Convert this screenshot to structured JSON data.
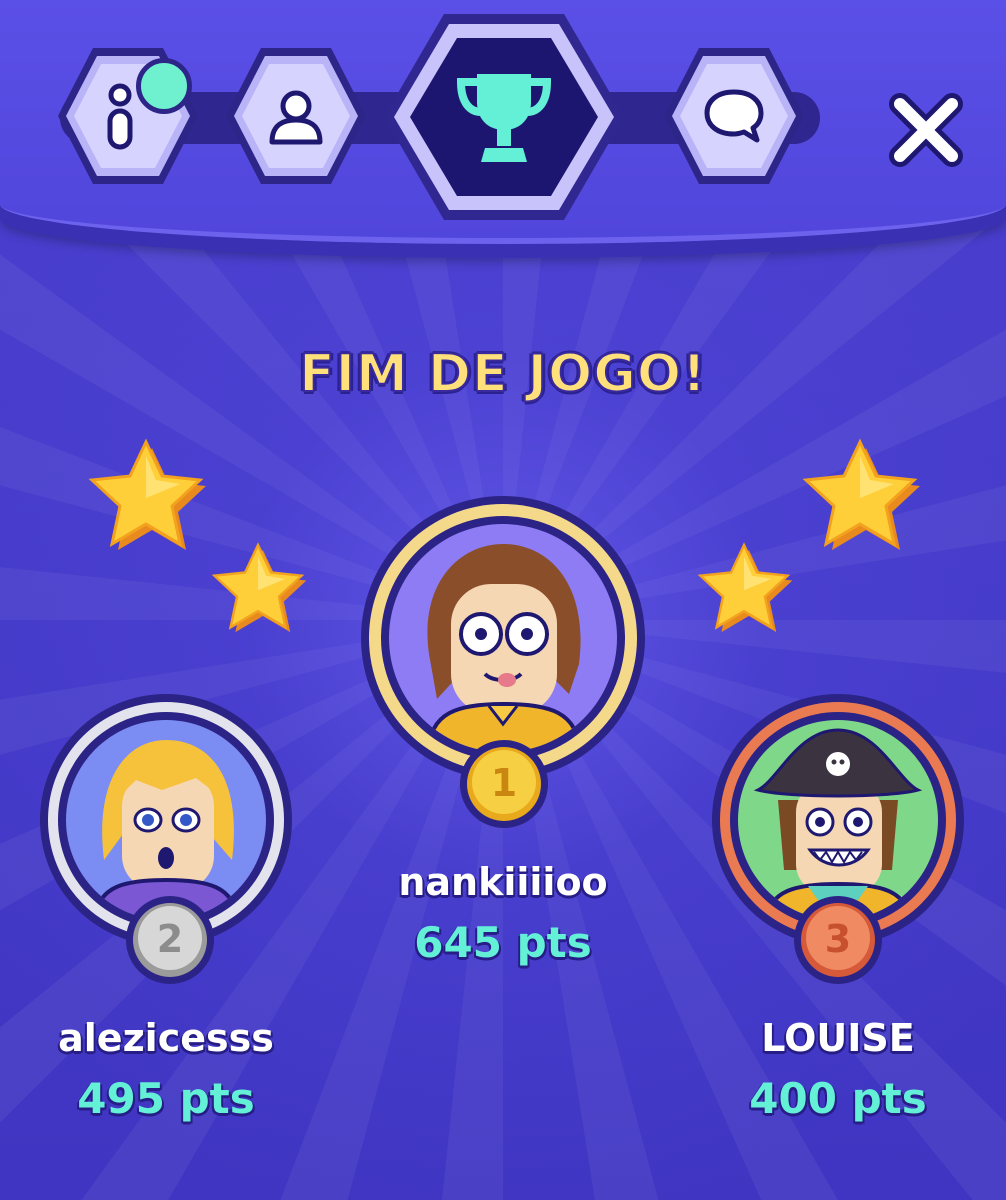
{
  "tabs": [
    {
      "name": "info",
      "icon": "info-icon",
      "active": false,
      "notification": true
    },
    {
      "name": "players",
      "icon": "user-icon",
      "active": false
    },
    {
      "name": "ranking",
      "icon": "trophy-icon",
      "active": true
    },
    {
      "name": "chat",
      "icon": "chat-bubble-icon",
      "active": false
    }
  ],
  "close_icon": "close-icon",
  "title": "FIM DE JOGO!",
  "podium": {
    "first": {
      "name": "nankiiiioo",
      "score": "645 pts",
      "rank": "1",
      "medal_color": "#f1c233"
    },
    "second": {
      "name": "alezicesss",
      "score": "495 pts",
      "rank": "2",
      "medal_color": "#c7c7c7"
    },
    "third": {
      "name": "LOUISE",
      "score": "400 pts",
      "rank": "3",
      "medal_color": "#f07c5a"
    }
  },
  "colors": {
    "background": "#4b3fd0",
    "title": "#ffe07a",
    "score": "#63f0d6",
    "tab_active": "#1d1670",
    "trophy": "#63f0d6"
  }
}
